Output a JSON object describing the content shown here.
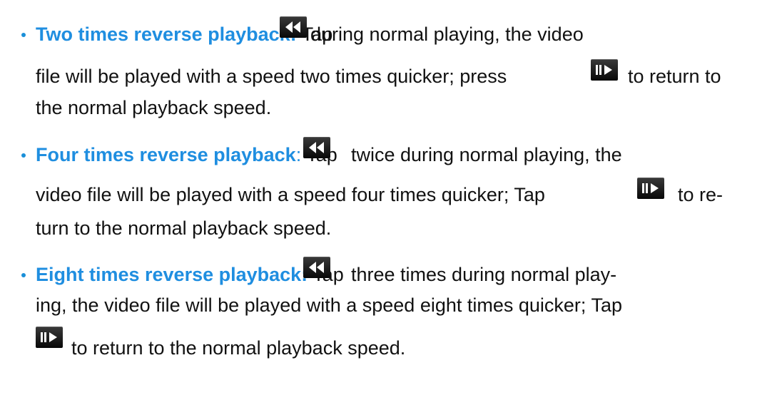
{
  "items": [
    {
      "heading": "Two times reverse playback:",
      "line1_a": "Tap",
      "line1_b": "during normal playing, the video",
      "line2_a": "file will be played with a speed two times quicker; press",
      "line2_b": "to return to",
      "line3": "the normal playback speed."
    },
    {
      "heading": "Four times reverse playback",
      "heading_colon": ":",
      "line1_a": "Tap",
      "line1_b": "twice during normal playing, the",
      "line2_a": "video file will be played with a speed four times quicker; Tap",
      "line2_b": "to re-",
      "line3": "turn to the normal playback speed."
    },
    {
      "heading": "Eight times reverse playback:",
      "line1_a": "Tap",
      "line1_b": "three times during normal play-",
      "line2": "ing, the video file will be played with a speed eight times quicker; Tap",
      "line3": "to return to the normal playback speed."
    }
  ],
  "icons": {
    "rewind": "rewind-icon",
    "play": "play-icon"
  },
  "colors": {
    "heading": "#1f8ee0",
    "bullet": "#1a8fd8",
    "text": "#111111",
    "icon_bg": "#111111"
  }
}
